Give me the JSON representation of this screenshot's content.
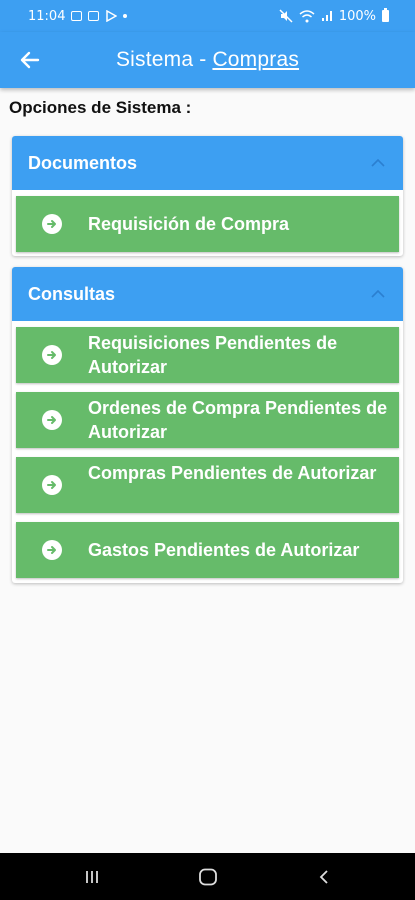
{
  "status_bar": {
    "time": "11:04",
    "battery": "100%"
  },
  "app_bar": {
    "title_prefix": "Sistema",
    "separator": "-",
    "title_link": "Compras"
  },
  "section_heading": "Opciones de Sistema :",
  "groups": [
    {
      "header": "Documentos",
      "items": [
        {
          "label": "Requisición de Compra"
        }
      ]
    },
    {
      "header": "Consultas",
      "items": [
        {
          "label": "Requisiciones Pendientes de Autorizar"
        },
        {
          "label": "Ordenes de Compra Pendientes de Autorizar"
        },
        {
          "label": "Compras Pendientes de Autorizar"
        },
        {
          "label": "Gastos Pendientes de Autorizar"
        }
      ]
    }
  ],
  "colors": {
    "primary": "#3d9ff2",
    "item_green": "#66bb6a"
  },
  "icons": {
    "back": "arrow-left-icon",
    "expand": "chevron-up-icon",
    "item": "arrow-circle-right-icon"
  }
}
